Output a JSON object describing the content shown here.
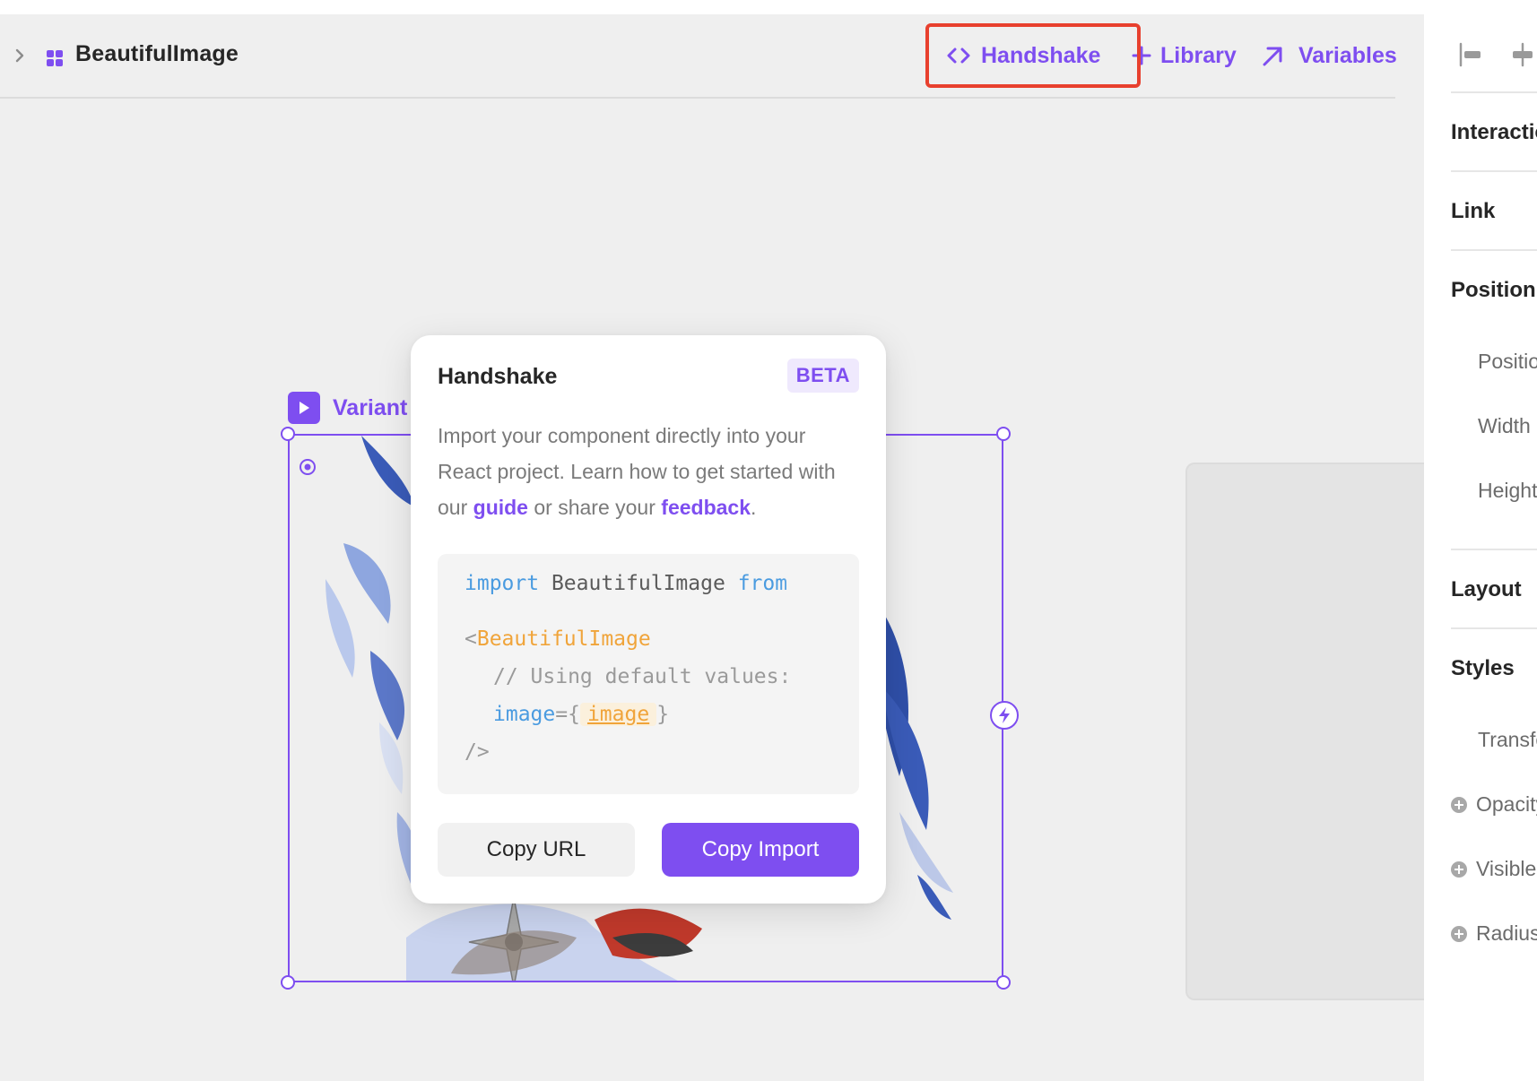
{
  "header": {
    "component_name": "BeautifulImage",
    "nav": [
      {
        "label": "Handshake",
        "icon": "code-brackets-icon"
      },
      {
        "label": "Library",
        "icon": "plus-icon"
      },
      {
        "label": "Variables",
        "icon": "arrow-up-right-icon"
      }
    ]
  },
  "canvas": {
    "variant_label": "Variant"
  },
  "popover": {
    "title": "Handshake",
    "badge": "BETA",
    "desc_part1": "Import your component directly into your React project. Learn how to get started with our ",
    "desc_link1": "guide",
    "desc_part2": " or share your ",
    "desc_link2": "feedback",
    "desc_part3": ".",
    "code": {
      "line1_kw": "import",
      "line1_name": "BeautifulImage",
      "line1_from": "from",
      "line2_open": "<",
      "line2_tag": "BeautifulImage",
      "line3_comment": "// Using default values:",
      "line4_attr": "image",
      "line4_eq": "={",
      "line4_value": "image",
      "line4_close": "}",
      "line5_close": "/>"
    },
    "copy_url_label": "Copy URL",
    "copy_import_label": "Copy Import"
  },
  "panel": {
    "sections": {
      "interactions": "Interactions",
      "link": "Link",
      "position": "Position",
      "layout": "Layout",
      "styles": "Styles"
    },
    "rows": {
      "position": "Position",
      "width": "Width",
      "height": "Height",
      "transforms": "Transforms",
      "opacity": "Opacity",
      "visible": "Visible",
      "radius": "Radius"
    }
  },
  "colors": {
    "accent": "#7e4ef0",
    "highlight": "#e8402e",
    "canvas_bg": "#efefef"
  }
}
